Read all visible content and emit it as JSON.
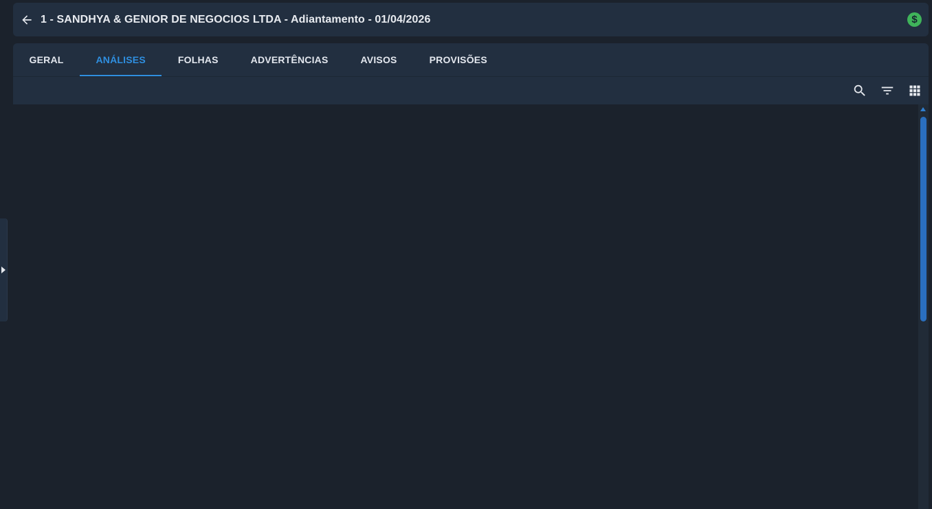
{
  "header": {
    "title": "1 - SANDHYA & GENIOR DE NEGOCIOS LTDA - Adiantamento - 01/04/2026",
    "back_icon": "arrow-left-icon",
    "status_icon": "dollar-circle-icon",
    "status_symbol": "$",
    "status_color": "#3fb35a"
  },
  "tabs": [
    {
      "label": "GERAL",
      "active": false
    },
    {
      "label": "ANÁLISES",
      "active": true
    },
    {
      "label": "FOLHAS",
      "active": false
    },
    {
      "label": "ADVERTÊNCIAS",
      "active": false
    },
    {
      "label": "AVISOS",
      "active": false
    },
    {
      "label": "PROVISÕES",
      "active": false
    }
  ],
  "toolbar": {
    "search_icon": "search-icon",
    "filter_icon": "filter-icon",
    "grid_icon": "grid-view-icon"
  },
  "colors": {
    "accent": "#2f8fe0",
    "background": "#1b222c",
    "panel": "#222f40"
  }
}
